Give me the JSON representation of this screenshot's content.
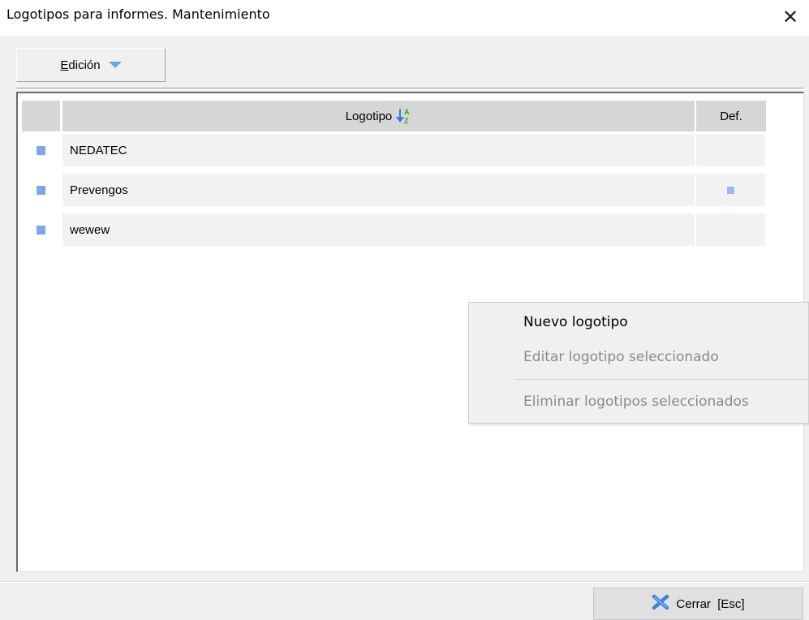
{
  "window": {
    "title": "Logotipos para informes. Mantenimiento",
    "close_glyph": "✕"
  },
  "toolbar": {
    "edicion_label": "Edición"
  },
  "grid": {
    "columns": {
      "logo": "Logotipo",
      "def": "Def."
    },
    "sort_icon": "sort-az-icon",
    "rows": [
      {
        "name": "NEDATEC",
        "default": false
      },
      {
        "name": "Prevengos",
        "default": true
      },
      {
        "name": "wewew",
        "default": false
      }
    ]
  },
  "context_menu": {
    "items": [
      {
        "label": "Nuevo logotipo",
        "enabled": true
      },
      {
        "label": "Editar logotipo seleccionado",
        "enabled": false
      },
      {
        "label": "Eliminar logotipos seleccionados",
        "enabled": false
      }
    ]
  },
  "footer": {
    "close_label": "Cerrar  [Esc]",
    "close_icon": "x-icon"
  },
  "colors": {
    "accent": "#7ea7e8",
    "sort_down": "#3b7be0",
    "sort_letters": "#2aa52a",
    "close_icon": "#3a86e0"
  }
}
